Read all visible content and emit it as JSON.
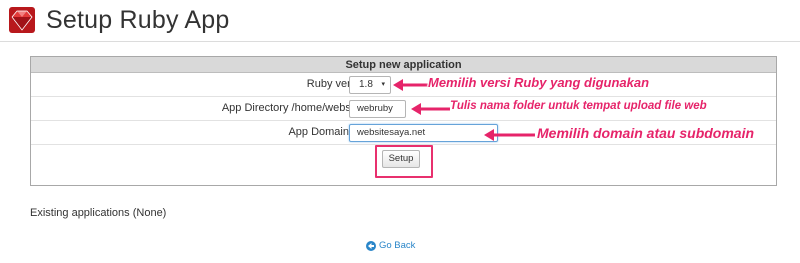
{
  "header": {
    "title": "Setup Ruby App",
    "logo_icon": "ruby-gem-icon"
  },
  "form": {
    "heading": "Setup new application",
    "ruby_version": {
      "label": "Ruby version",
      "value": "1.8",
      "caret": "▾"
    },
    "app_directory": {
      "label": "App Directory /home/websites/",
      "value": "webruby"
    },
    "app_domain": {
      "label": "App Domain/URI",
      "value": "websitesaya.net"
    },
    "setup_button": "Setup"
  },
  "annotations": {
    "ruby_version": "Memilih versi Ruby yang digunakan",
    "app_directory": "Tulis nama folder untuk tempat upload file web",
    "app_domain": "Memilih domain atau subdomain",
    "color": "#e6246a"
  },
  "existing": "Existing applications (None)",
  "go_back": "Go Back",
  "colors": {
    "accent": "#e6246a",
    "link": "#2a86c9",
    "panel_head": "#d9d9d9"
  }
}
